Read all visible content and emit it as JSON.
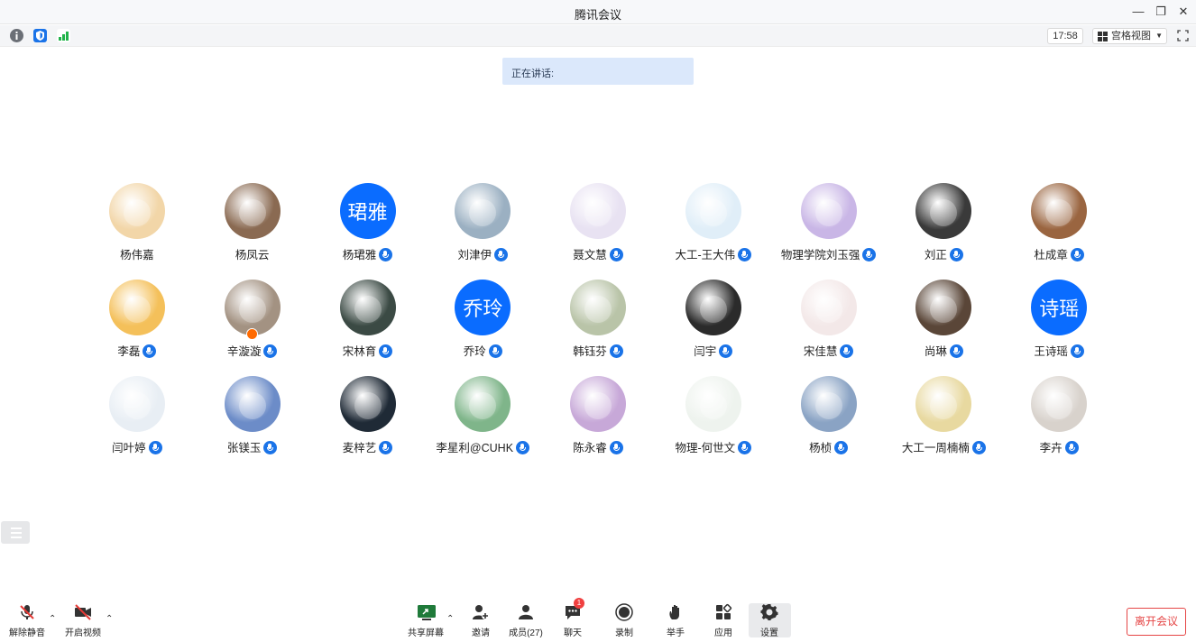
{
  "window": {
    "title": "腾讯会议",
    "minimize_glyph": "—",
    "restore_glyph": "❐",
    "close_glyph": "✕"
  },
  "top_toolbar": {
    "time": "17:58",
    "view_mode": "宫格视图",
    "icons": [
      "info-icon",
      "shield-icon",
      "signal-icon",
      "fullscreen-icon"
    ]
  },
  "speaking": {
    "label": "正在讲话:"
  },
  "participants": [
    [
      {
        "name": "杨伟嘉",
        "avatar": "tiger-cartoon",
        "mic": false,
        "color": "#f2d6a8"
      },
      {
        "name": "杨凤云",
        "avatar": "photo",
        "mic": false,
        "color": "#8a6a52"
      },
      {
        "name": "杨珺雅",
        "avatar_text": "珺雅",
        "mic": true
      },
      {
        "name": "刘津伊",
        "avatar": "photo",
        "mic": true,
        "color": "#9bb0c2"
      },
      {
        "name": "聂文慧",
        "avatar": "cartoon",
        "mic": true,
        "color": "#e8e2f2"
      },
      {
        "name": "大工-王大伟",
        "avatar": "panda-cartoon",
        "mic": true,
        "color": "#e0eef8"
      },
      {
        "name": "物理学院刘玉强",
        "avatar": "cartoon",
        "mic": true,
        "color": "#c9b6e6"
      },
      {
        "name": "刘正",
        "avatar": "photo",
        "mic": true,
        "color": "#3a3a3a"
      },
      {
        "name": "杜成章",
        "avatar": "photo",
        "mic": true,
        "color": "#9a6540"
      }
    ],
    [
      {
        "name": "李磊",
        "avatar": "cartoon",
        "mic": true,
        "color": "#f4c05a"
      },
      {
        "name": "辛漩漩",
        "avatar": "cartoon",
        "mic": true,
        "host": true,
        "color": "#a39282"
      },
      {
        "name": "宋林育",
        "avatar": "photo",
        "mic": true,
        "color": "#3b4a44"
      },
      {
        "name": "乔玲",
        "avatar_text": "乔玲",
        "mic": true
      },
      {
        "name": "韩钰芬",
        "avatar": "bear-photo",
        "mic": true,
        "color": "#b9c4a8"
      },
      {
        "name": "闫宇",
        "avatar": "cat-photo",
        "mic": true,
        "color": "#2b2b2b"
      },
      {
        "name": "宋佳慧",
        "avatar": "cartoon",
        "mic": true,
        "color": "#f3e8e8"
      },
      {
        "name": "尚琳",
        "avatar": "photo",
        "mic": true,
        "color": "#5a4638"
      },
      {
        "name": "王诗瑶",
        "avatar_text": "诗瑶",
        "mic": true
      }
    ],
    [
      {
        "name": "闫叶婷",
        "avatar": "photo",
        "mic": true,
        "color": "#e8eef4"
      },
      {
        "name": "张镁玉",
        "avatar": "cartoon",
        "mic": true,
        "color": "#6c8cc8"
      },
      {
        "name": "麦梓艺",
        "avatar": "photo",
        "mic": true,
        "color": "#1f2a36"
      },
      {
        "name": "李星利@CUHK",
        "avatar": "landscape",
        "mic": true,
        "color": "#7fb58a"
      },
      {
        "name": "陈永睿",
        "avatar": "tiger-cartoon",
        "mic": true,
        "color": "#c7a8d8"
      },
      {
        "name": "物理-何世文",
        "avatar": "sketch",
        "mic": true,
        "color": "#eef3ee"
      },
      {
        "name": "杨桢",
        "avatar": "sea-photo",
        "mic": true,
        "color": "#8aa3c4"
      },
      {
        "name": "大工一周楠楠",
        "avatar": "cartoon",
        "mic": true,
        "color": "#e8d9a0"
      },
      {
        "name": "李卉",
        "avatar": "photo",
        "mic": true,
        "color": "#d8d2cc"
      }
    ]
  ],
  "bottom_bar": {
    "unmute": "解除静音",
    "start_video": "开启视频",
    "share_screen": "共享屏幕",
    "invite": "邀请",
    "members": "成员(27)",
    "chat": "聊天",
    "chat_badge": "1",
    "record": "录制",
    "raise_hand": "举手",
    "apps": "应用",
    "settings": "设置",
    "leave": "离开会议"
  }
}
